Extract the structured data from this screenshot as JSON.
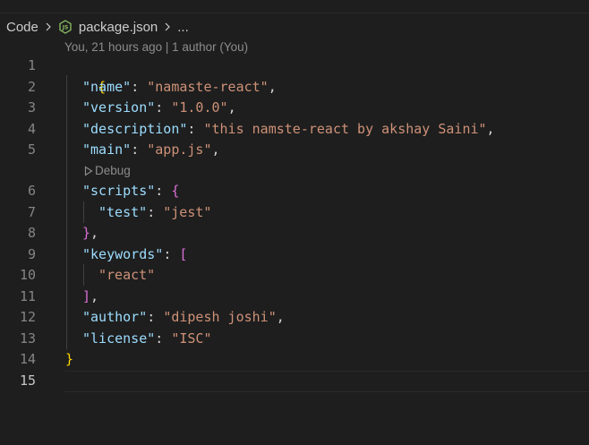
{
  "breadcrumb": {
    "root": "Code",
    "file": "package.json",
    "more": "..."
  },
  "blame": "You, 21 hours ago | 1 author (You)",
  "debug_lens": "Debug",
  "colors": {
    "background": "#1e1e1e",
    "key": "#9cdcfe",
    "string": "#ce9178",
    "punctuation": "#d4d4d4",
    "brace_level1": "#ffd700",
    "brace_level2": "#da70d6",
    "line_number": "#858585"
  },
  "lines": [
    {
      "num": "1",
      "open": "{"
    },
    {
      "num": "2",
      "key": "\"name\"",
      "colon": ": ",
      "value": "\"namaste-react\"",
      "tail": ","
    },
    {
      "num": "3",
      "key": "\"version\"",
      "colon": ": ",
      "value": "\"1.0.0\"",
      "tail": ","
    },
    {
      "num": "4",
      "key": "\"description\"",
      "colon": ": ",
      "value": "\"this namste-react by akshay Saini\"",
      "tail": ","
    },
    {
      "num": "5",
      "key": "\"main\"",
      "colon": ": ",
      "value": "\"app.js\"",
      "tail": ","
    },
    {
      "num": "6",
      "key": "\"scripts\"",
      "colon": ": ",
      "bracket": "{"
    },
    {
      "num": "7",
      "key": "\"test\"",
      "colon": ": ",
      "value": "\"jest\""
    },
    {
      "num": "8",
      "bracket": "}",
      "tail": ","
    },
    {
      "num": "9",
      "key": "\"keywords\"",
      "colon": ": ",
      "bracket": "["
    },
    {
      "num": "10",
      "value": "\"react\""
    },
    {
      "num": "11",
      "bracket": "]",
      "tail": ","
    },
    {
      "num": "12",
      "key": "\"author\"",
      "colon": ": ",
      "value": "\"dipesh joshi\"",
      "tail": ","
    },
    {
      "num": "13",
      "key": "\"license\"",
      "colon": ": ",
      "value": "\"ISC\""
    },
    {
      "num": "14",
      "close": "}"
    },
    {
      "num": "15"
    }
  ]
}
